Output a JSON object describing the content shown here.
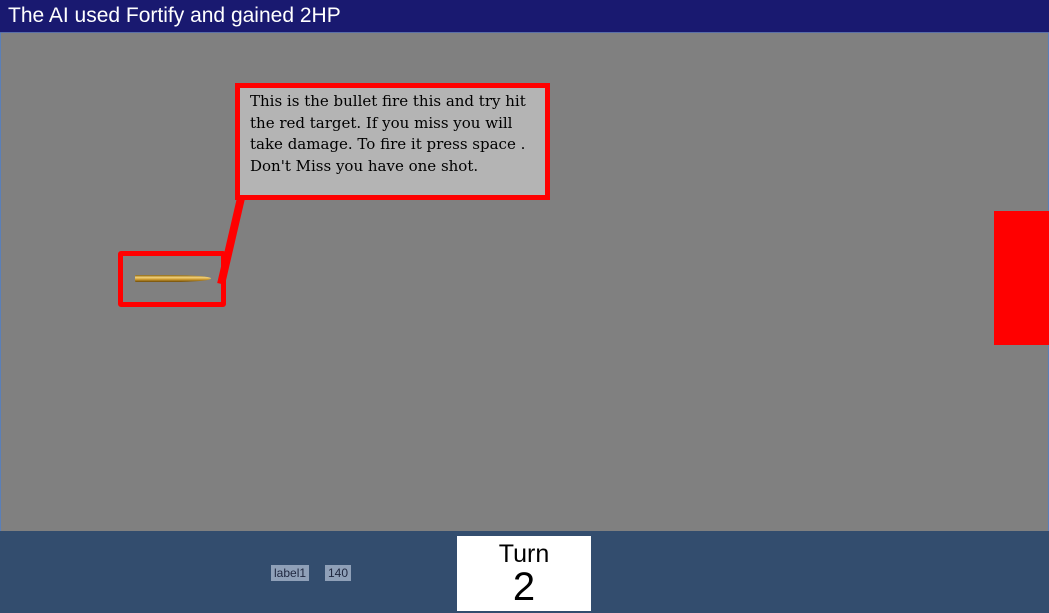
{
  "status_bar": {
    "message": "The AI used Fortify and gained 2HP"
  },
  "tutorial": {
    "text": "This is the bullet fire this and try hit the red target. If you miss you will take damage. To fire it press space . Don't Miss you have one shot."
  },
  "game": {
    "bullet_icon": "bullet-icon",
    "target_color": "#ff0000"
  },
  "hud": {
    "label1": "label1",
    "value_label": "140",
    "turn_label": "Turn",
    "turn_value": "2"
  },
  "colors": {
    "title_bar": "#191970",
    "background": "#808080",
    "bottom_bar": "#334d6e",
    "highlight": "#ff0000",
    "tooltip_bg": "#b4b4b4"
  }
}
